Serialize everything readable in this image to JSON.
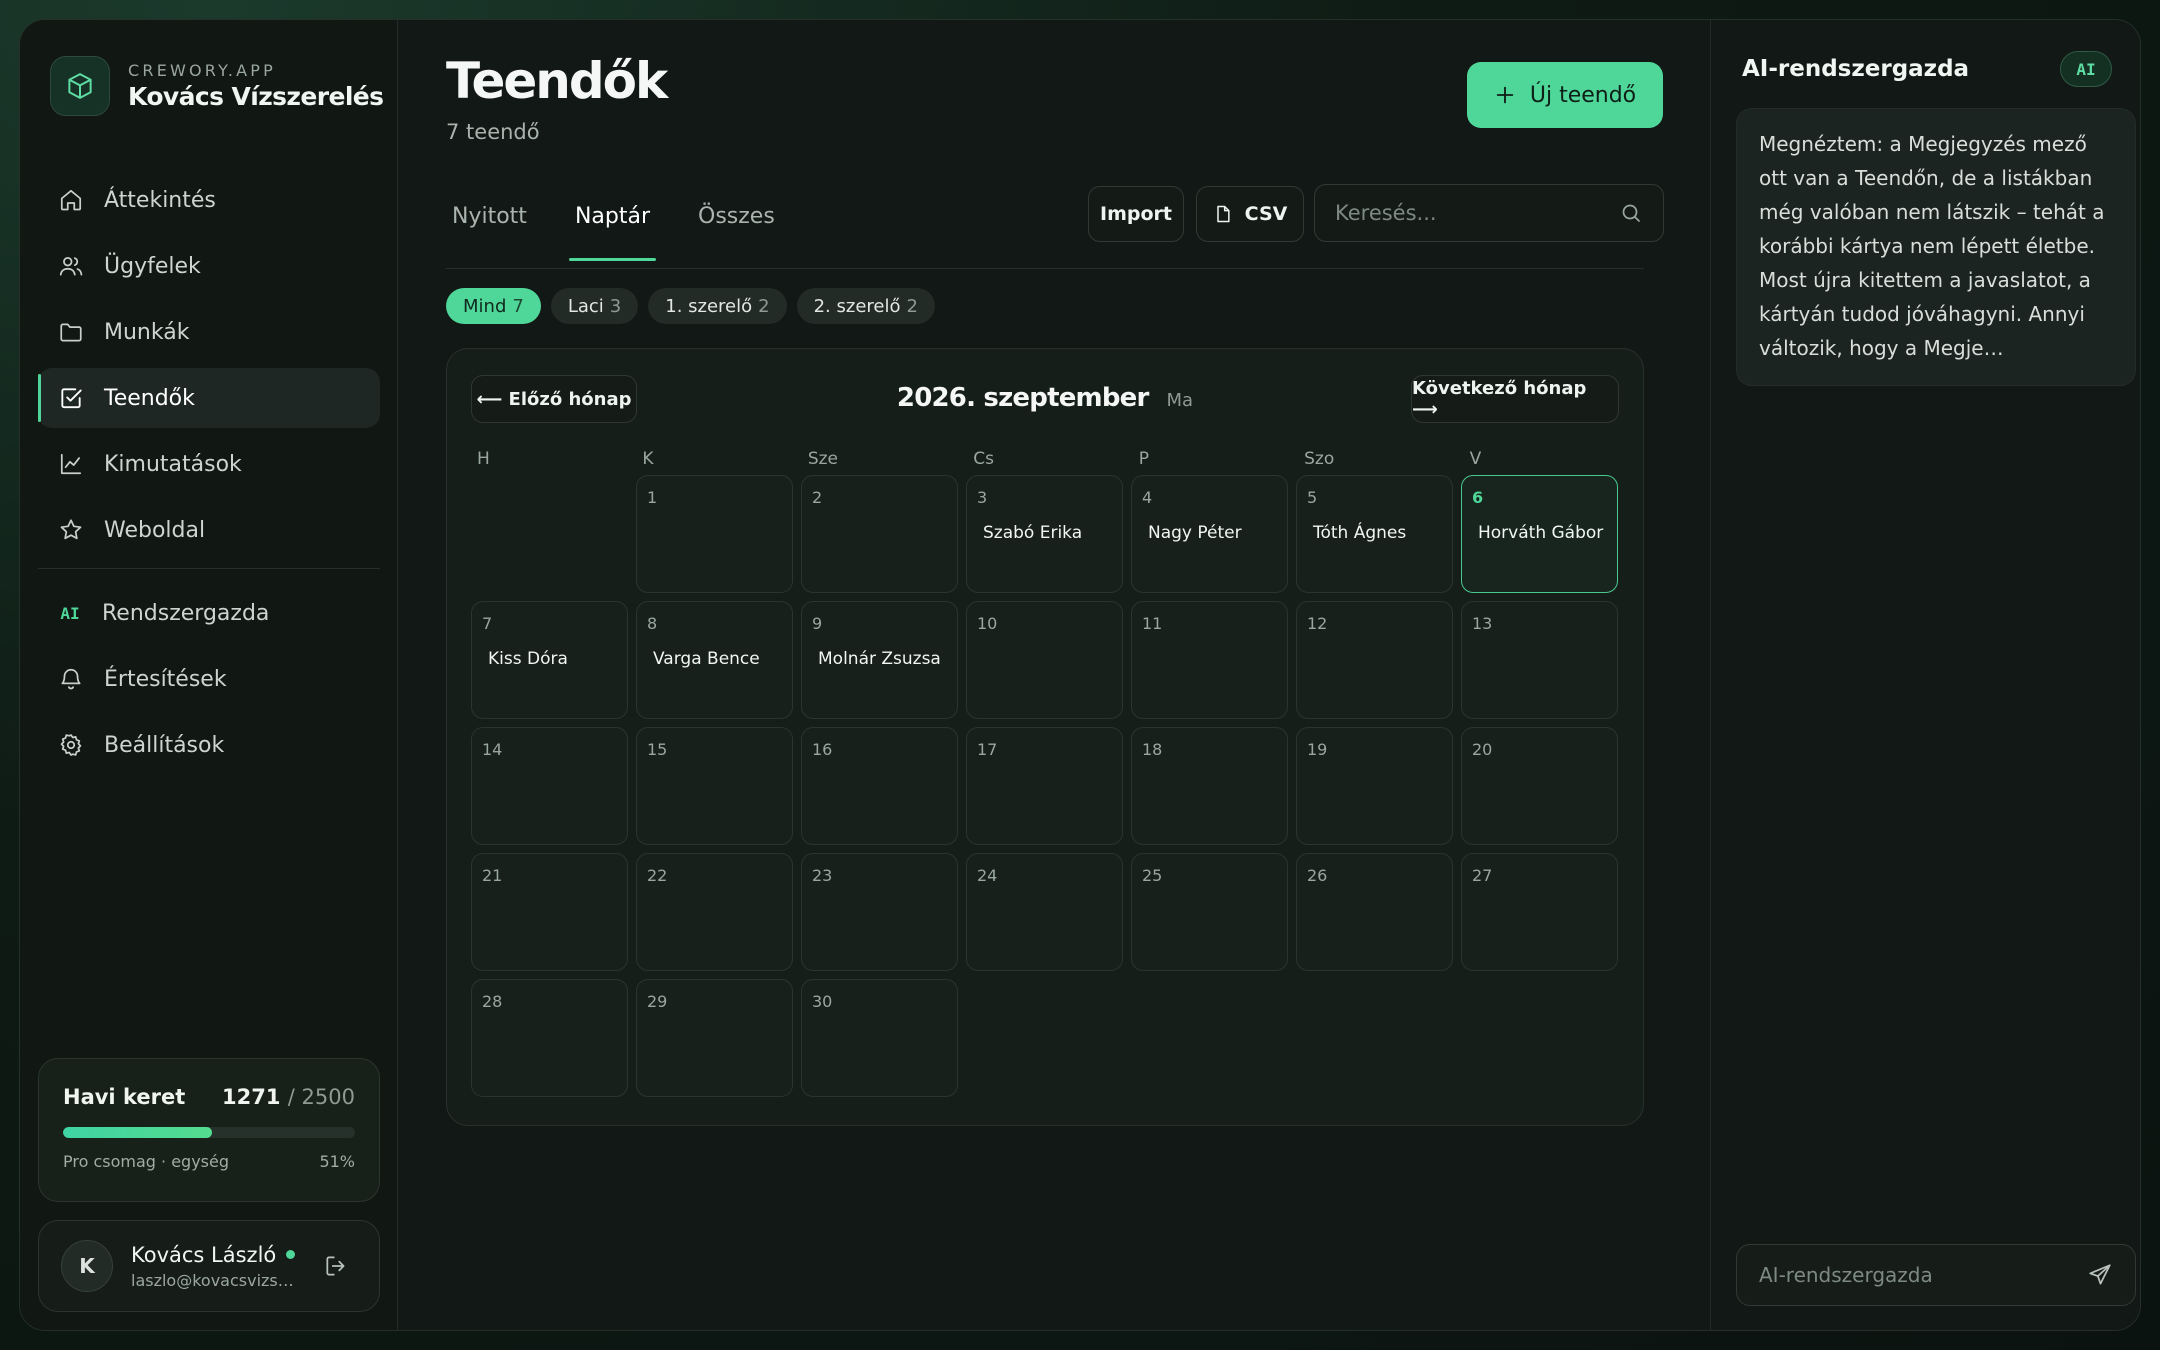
{
  "brand": {
    "kicker": "CREWORY.APP",
    "name": "Kovács Vízszerelés"
  },
  "nav": {
    "primary": [
      {
        "label": "Áttekintés",
        "icon": "home-icon"
      },
      {
        "label": "Ügyfelek",
        "icon": "users-icon"
      },
      {
        "label": "Munkák",
        "icon": "folder-icon"
      },
      {
        "label": "Teendők",
        "icon": "check-square-icon",
        "active": true
      },
      {
        "label": "Kimutatások",
        "icon": "chart-icon"
      },
      {
        "label": "Weboldal",
        "icon": "star-icon"
      }
    ],
    "secondary": [
      {
        "label": "Rendszergazda",
        "icon": "ai-icon",
        "glyph": "AI"
      },
      {
        "label": "Értesítések",
        "icon": "bell-icon"
      },
      {
        "label": "Beállítások",
        "icon": "gear-icon"
      }
    ]
  },
  "quota": {
    "title": "Havi keret",
    "used": "1271",
    "total": "/ 2500",
    "plan": "Pro csomag · egység",
    "percent_label": "51%",
    "percent": 51
  },
  "user": {
    "initial": "K",
    "name": "Kovács László",
    "email": "laszlo@kovacsvizsz..."
  },
  "header": {
    "title": "Teendők",
    "subtitle": "7 teendő",
    "new_button": "Új teendő"
  },
  "tabs": [
    {
      "label": "Nyitott"
    },
    {
      "label": "Naptár",
      "active": true
    },
    {
      "label": "Összes"
    }
  ],
  "toolbar": {
    "import_label": "Import",
    "csv_label": "CSV",
    "search_placeholder": "Keresés..."
  },
  "filters": [
    {
      "label": "Mind",
      "count": "7",
      "active": true
    },
    {
      "label": "Laci",
      "count": "3"
    },
    {
      "label": "1. szerelő",
      "count": "2"
    },
    {
      "label": "2. szerelő",
      "count": "2"
    }
  ],
  "calendar": {
    "prev_label": "⟵ Előző hónap",
    "next_label": "Következő hónap ⟶",
    "month_title": "2026. szeptember",
    "today_label": "Ma",
    "weekdays": [
      "H",
      "K",
      "Sze",
      "Cs",
      "P",
      "Szo",
      "V"
    ],
    "leading_empty": 1,
    "days": [
      {
        "num": "1",
        "event": ""
      },
      {
        "num": "2",
        "event": ""
      },
      {
        "num": "3",
        "event": "Szabó Erika"
      },
      {
        "num": "4",
        "event": "Nagy Péter"
      },
      {
        "num": "5",
        "event": "Tóth Ágnes"
      },
      {
        "num": "6",
        "event": "Horváth Gábor",
        "today": true
      },
      {
        "num": "7",
        "event": "Kiss Dóra"
      },
      {
        "num": "8",
        "event": "Varga Bence"
      },
      {
        "num": "9",
        "event": "Molnár Zsuzsa"
      },
      {
        "num": "10",
        "event": ""
      },
      {
        "num": "11",
        "event": ""
      },
      {
        "num": "12",
        "event": ""
      },
      {
        "num": "13",
        "event": ""
      },
      {
        "num": "14",
        "event": ""
      },
      {
        "num": "15",
        "event": ""
      },
      {
        "num": "16",
        "event": ""
      },
      {
        "num": "17",
        "event": ""
      },
      {
        "num": "18",
        "event": ""
      },
      {
        "num": "19",
        "event": ""
      },
      {
        "num": "20",
        "event": ""
      },
      {
        "num": "21",
        "event": ""
      },
      {
        "num": "22",
        "event": ""
      },
      {
        "num": "23",
        "event": ""
      },
      {
        "num": "24",
        "event": ""
      },
      {
        "num": "25",
        "event": ""
      },
      {
        "num": "26",
        "event": ""
      },
      {
        "num": "27",
        "event": ""
      },
      {
        "num": "28",
        "event": ""
      },
      {
        "num": "29",
        "event": ""
      },
      {
        "num": "30",
        "event": ""
      }
    ]
  },
  "ai_panel": {
    "title": "AI-rendszergazda",
    "badge": "AI",
    "message": "Megnéztem: a Megjegyzés mező ott van a Teendőn, de a listákban még valóban nem látszik – tehát a korábbi kártya nem lépett életbe. Most újra kitettem a javaslatot, a kártyán tudod jóváhagyni. Annyi változik, hogy a Megje…",
    "input_placeholder": "AI-rendszergazda"
  },
  "colors": {
    "accent": "#4fd699",
    "background": "#121815",
    "panel": "#161e1a"
  }
}
